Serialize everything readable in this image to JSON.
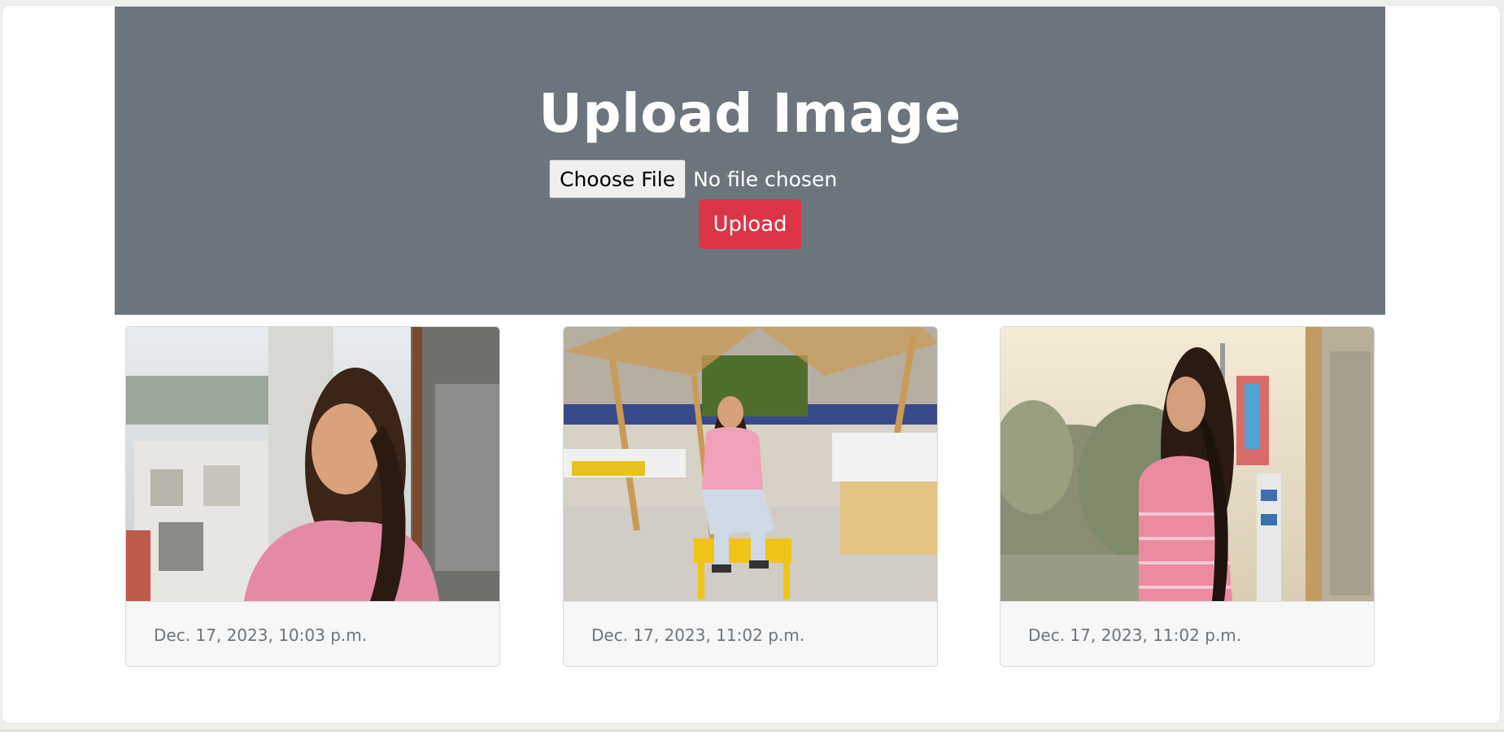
{
  "hero": {
    "title": "Upload Image",
    "choose_file_label": "Choose File",
    "no_file_text": "No file chosen",
    "upload_label": "Upload"
  },
  "gallery": {
    "cards": [
      {
        "date": "Dec. 17, 2023, 10:03 p.m."
      },
      {
        "date": "Dec. 17, 2023, 11:02 p.m."
      },
      {
        "date": "Dec. 17, 2023, 11:02 p.m."
      }
    ]
  },
  "colors": {
    "hero_bg": "#6c757d",
    "upload_button": "#dc3545",
    "footer_text": "#6c757d"
  }
}
